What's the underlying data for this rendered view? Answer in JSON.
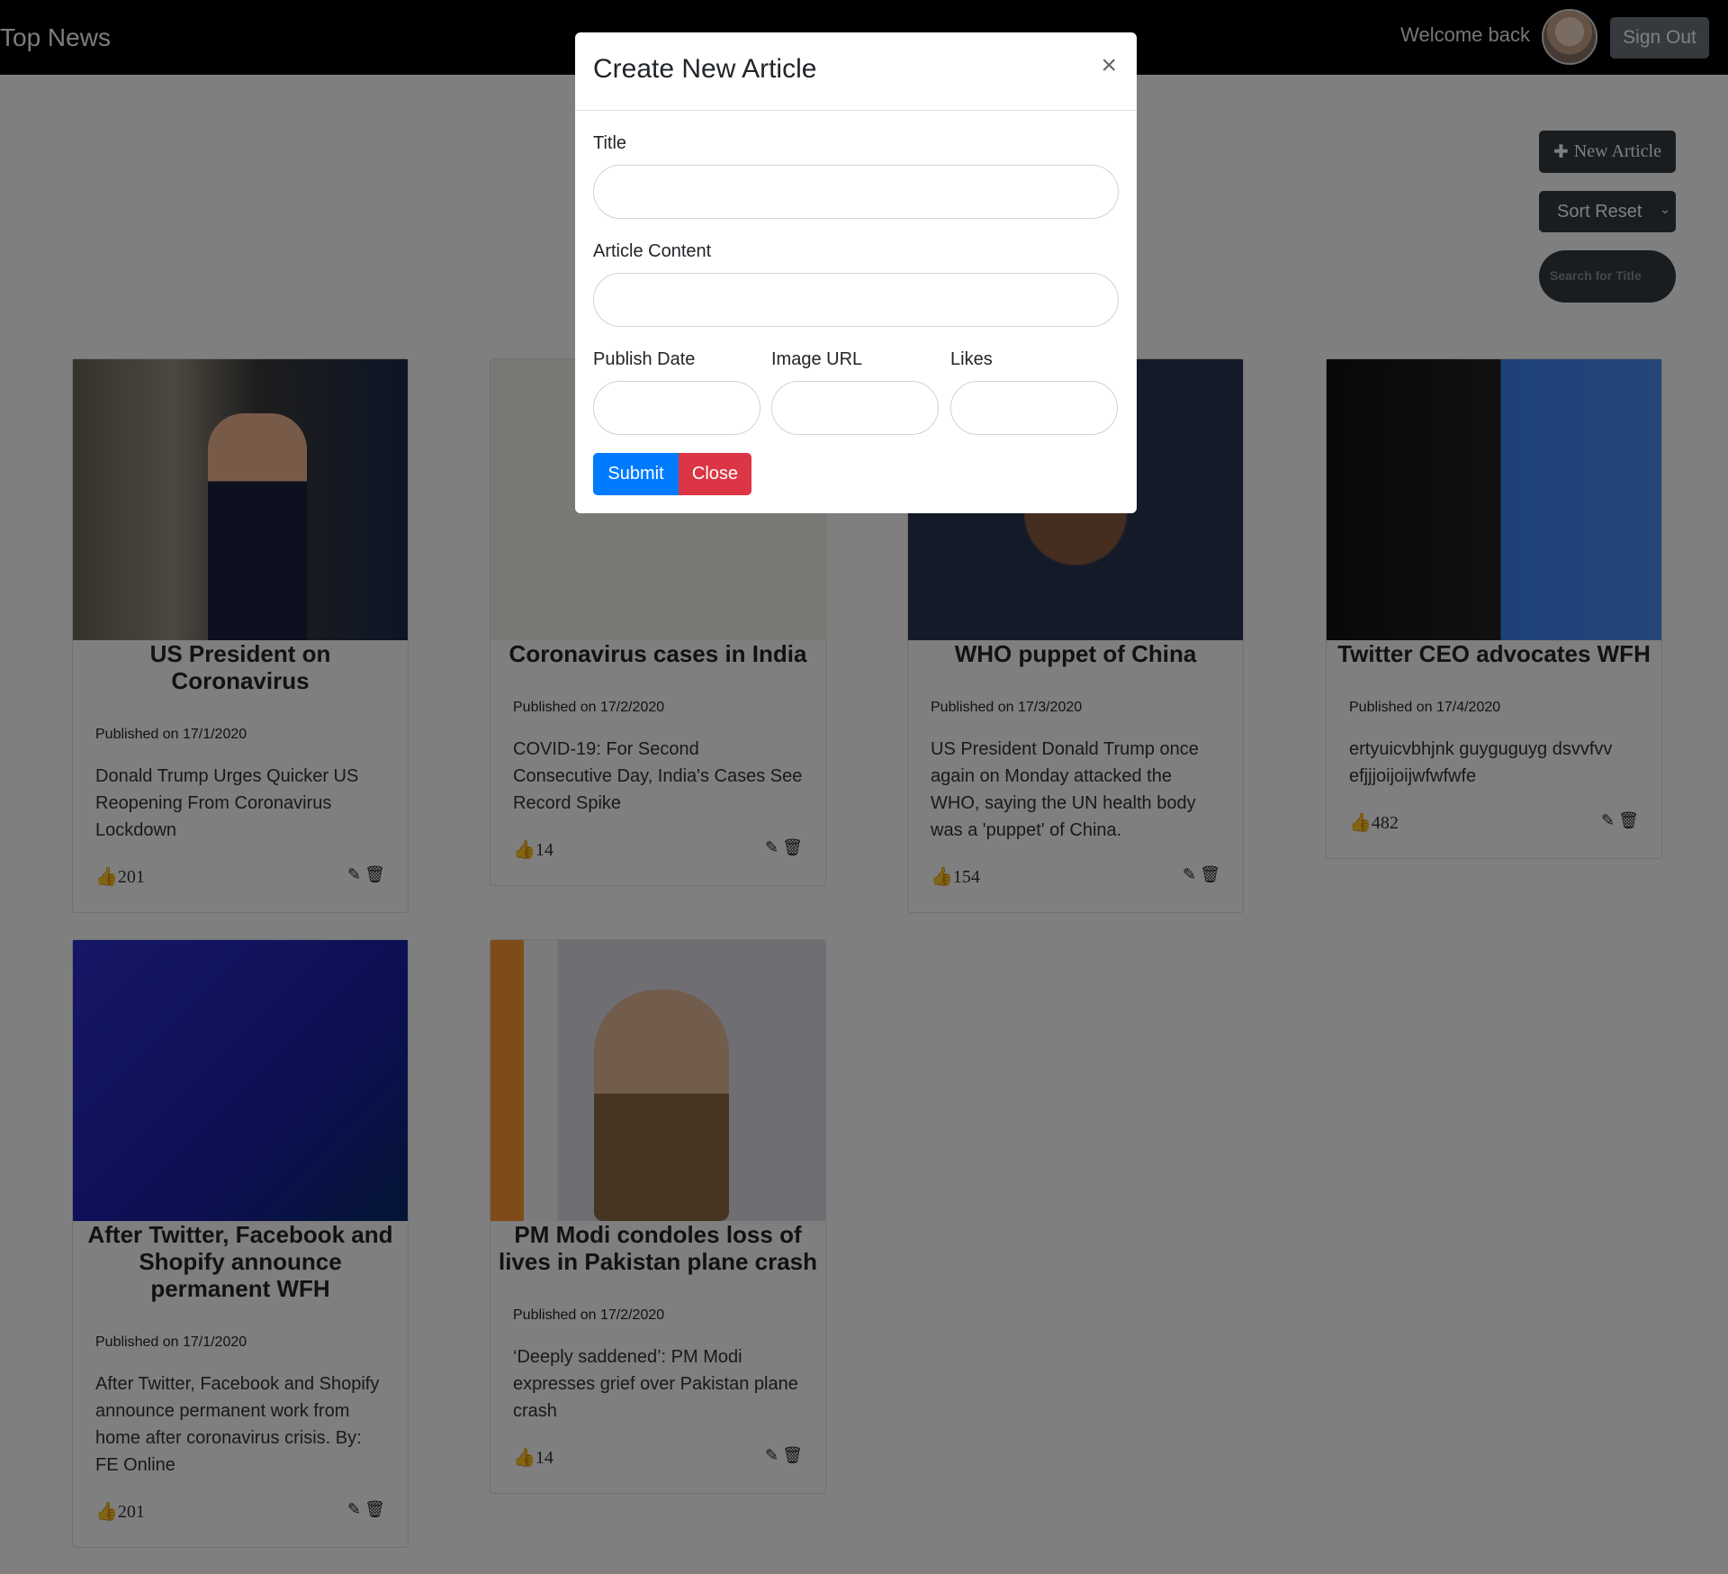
{
  "navbar": {
    "brand": "Top News",
    "welcome": "Welcome back",
    "sign_out": "Sign Out"
  },
  "controls": {
    "new_article": "New Article",
    "sort": "Sort Reset",
    "search_placeholder": "Search for Title"
  },
  "articles": [
    {
      "title": "US President on Coronavirus",
      "date": "Published on 17/1/2020",
      "desc": "Donald Trump Urges Quicker US Reopening From Coronavirus Lockdown",
      "likes": "201"
    },
    {
      "title": "Coronavirus cases in India",
      "date": "Published on 17/2/2020",
      "desc": "COVID-19: For Second Consecutive Day, India's Cases See Record Spike",
      "likes": "14"
    },
    {
      "title": "WHO puppet of China",
      "date": "Published on 17/3/2020",
      "desc": "US President Donald Trump once again on Monday attacked the WHO, saying the UN health body was a 'puppet' of China.",
      "likes": "154"
    },
    {
      "title": "Twitter CEO advocates WFH",
      "date": "Published on 17/4/2020",
      "desc": "ertyuicvbhjnk guyguguyg dsvvfvv efjjjoijoijwfwfwfe",
      "likes": "482"
    },
    {
      "title": "After Twitter, Facebook and Shopify announce permanent WFH",
      "date": "Published on 17/1/2020",
      "desc": "After Twitter, Facebook and Shopify announce permanent work from home after coronavirus crisis. By: FE Online",
      "likes": "201"
    },
    {
      "title": "PM Modi condoles loss of lives in Pakistan plane crash",
      "date": "Published on 17/2/2020",
      "desc": "‘Deeply saddened’: PM Modi expresses grief over Pakistan plane crash",
      "likes": "14"
    }
  ],
  "modal": {
    "title": "Create New Article",
    "close_glyph": "×",
    "label_title": "Title",
    "label_content": "Article Content",
    "label_date": "Publish Date",
    "label_image": "Image URL",
    "label_likes": "Likes",
    "submit": "Submit",
    "close": "Close"
  }
}
